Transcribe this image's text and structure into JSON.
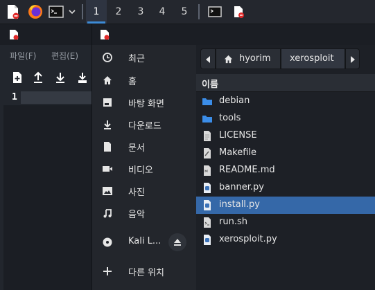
{
  "taskbar": {
    "workspaces": [
      "1",
      "2",
      "3",
      "4",
      "5"
    ],
    "active_workspace": "1",
    "accent": "#3d8bd6"
  },
  "editor": {
    "menus": [
      "파일(F)",
      "편집(E)"
    ],
    "line_numbers": [
      "1"
    ]
  },
  "places": [
    {
      "icon": "clock-icon",
      "label": "최근"
    },
    {
      "icon": "home-icon",
      "label": "홈"
    },
    {
      "icon": "desktop-icon",
      "label": "바탕 화면"
    },
    {
      "icon": "download-icon",
      "label": "다운로드"
    },
    {
      "icon": "document-icon",
      "label": "문서"
    },
    {
      "icon": "video-icon",
      "label": "비디오"
    },
    {
      "icon": "picture-icon",
      "label": "사진"
    },
    {
      "icon": "music-icon",
      "label": "음악"
    },
    {
      "icon": "disc-icon",
      "label": "Kali L..."
    },
    {
      "icon": "plus-icon",
      "label": "다른 위치"
    }
  ],
  "pathbar": {
    "home_label": "hyorim",
    "current_label": "xerosploit"
  },
  "filelist": {
    "column_header": "이름",
    "selection_color": "#3568a8",
    "files": [
      {
        "name": "debian",
        "icon": "folder-icon"
      },
      {
        "name": "tools",
        "icon": "folder-icon"
      },
      {
        "name": "LICENSE",
        "icon": "text-file-icon"
      },
      {
        "name": "Makefile",
        "icon": "makefile-icon"
      },
      {
        "name": "README.md",
        "icon": "markdown-file-icon"
      },
      {
        "name": "banner.py",
        "icon": "python-file-icon"
      },
      {
        "name": "install.py",
        "icon": "python-file-icon",
        "selected": true
      },
      {
        "name": "run.sh",
        "icon": "shell-script-icon"
      },
      {
        "name": "xerosploit.py",
        "icon": "python-file-icon"
      }
    ]
  }
}
